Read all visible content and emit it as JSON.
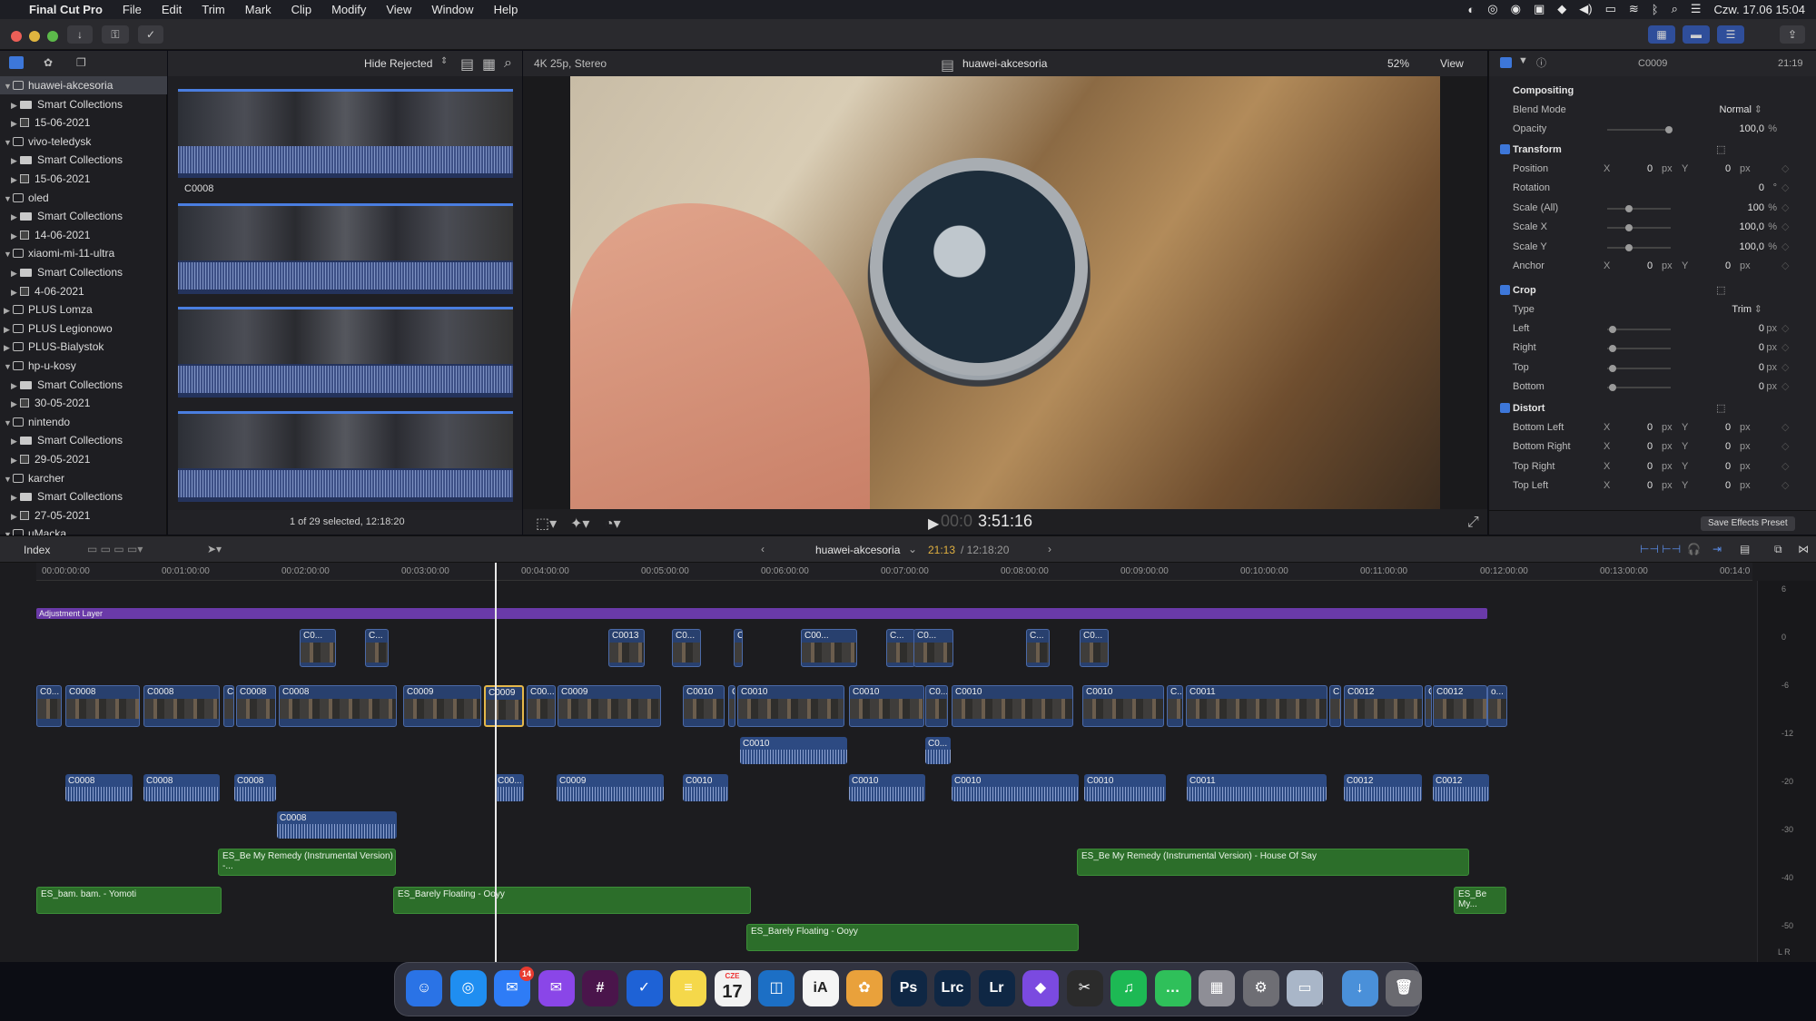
{
  "menubar": {
    "app_name": "Final Cut Pro",
    "items": [
      "File",
      "Edit",
      "Trim",
      "Mark",
      "Clip",
      "Modify",
      "View",
      "Window",
      "Help"
    ],
    "clock": "Czw. 17.06  15:04"
  },
  "libraries": {
    "items": [
      {
        "label": "huawei-akcesoria",
        "kind": "library",
        "selected": true
      },
      {
        "label": "Smart Collections",
        "kind": "folder"
      },
      {
        "label": "15-06-2021",
        "kind": "event"
      },
      {
        "label": "vivo-teledysk",
        "kind": "library"
      },
      {
        "label": "Smart Collections",
        "kind": "folder"
      },
      {
        "label": "15-06-2021",
        "kind": "event"
      },
      {
        "label": "oled",
        "kind": "library"
      },
      {
        "label": "Smart Collections",
        "kind": "folder"
      },
      {
        "label": "14-06-2021",
        "kind": "event"
      },
      {
        "label": "xiaomi-mi-11-ultra",
        "kind": "library"
      },
      {
        "label": "Smart Collections",
        "kind": "folder"
      },
      {
        "label": "4-06-2021",
        "kind": "event"
      },
      {
        "label": "PLUS Lomza",
        "kind": "library"
      },
      {
        "label": "PLUS Legionowo",
        "kind": "library"
      },
      {
        "label": "PLUS-Bialystok",
        "kind": "library"
      },
      {
        "label": "hp-u-kosy",
        "kind": "library"
      },
      {
        "label": "Smart Collections",
        "kind": "folder"
      },
      {
        "label": "30-05-2021",
        "kind": "event"
      },
      {
        "label": "nintendo",
        "kind": "library"
      },
      {
        "label": "Smart Collections",
        "kind": "folder"
      },
      {
        "label": "29-05-2021",
        "kind": "event"
      },
      {
        "label": "karcher",
        "kind": "library"
      },
      {
        "label": "Smart Collections",
        "kind": "folder"
      },
      {
        "label": "27-05-2021",
        "kind": "event"
      },
      {
        "label": "uMacka",
        "kind": "library"
      }
    ]
  },
  "browser": {
    "filter": "Hide Rejected",
    "clip_name": "C0008",
    "status": "1 of 29 selected, 12:18:20"
  },
  "viewer": {
    "format": "4K 25p, Stereo",
    "project": "huawei-akcesoria",
    "zoom": "52%",
    "view_menu": "View",
    "timecode_dim": "00:0",
    "timecode": "3:51:16"
  },
  "inspector": {
    "clip": "C0009",
    "duration": "21:19",
    "compositing": {
      "title": "Compositing",
      "blend_label": "Blend Mode",
      "blend": "Normal",
      "opacity_label": "Opacity",
      "opacity": "100,0"
    },
    "transform": {
      "title": "Transform",
      "rows": [
        {
          "label": "Position",
          "x": "0",
          "y": "0",
          "unit": "px"
        },
        {
          "label": "Rotation",
          "value": "0",
          "unit": "°"
        },
        {
          "label": "Scale (All)",
          "value": "100",
          "unit": "%"
        },
        {
          "label": "Scale X",
          "value": "100,0",
          "unit": "%"
        },
        {
          "label": "Scale Y",
          "value": "100,0",
          "unit": "%"
        },
        {
          "label": "Anchor",
          "x": "0",
          "y": "0",
          "unit": "px"
        }
      ]
    },
    "crop": {
      "title": "Crop",
      "type_label": "Type",
      "type": "Trim",
      "rows": [
        {
          "label": "Left",
          "value": "0",
          "unit": "px"
        },
        {
          "label": "Right",
          "value": "0",
          "unit": "px"
        },
        {
          "label": "Top",
          "value": "0",
          "unit": "px"
        },
        {
          "label": "Bottom",
          "value": "0",
          "unit": "px"
        }
      ]
    },
    "distort": {
      "title": "Distort",
      "rows": [
        {
          "label": "Bottom Left",
          "x": "0",
          "y": "0",
          "unit": "px"
        },
        {
          "label": "Bottom Right",
          "x": "0",
          "y": "0",
          "unit": "px"
        },
        {
          "label": "Top Right",
          "x": "0",
          "y": "0",
          "unit": "px"
        },
        {
          "label": "Top Left",
          "x": "0",
          "y": "0",
          "unit": "px"
        }
      ]
    },
    "save_preset": "Save Effects Preset"
  },
  "timeline": {
    "index_label": "Index",
    "project": "huawei-akcesoria",
    "position": "21:13",
    "duration": "/ 12:18:20",
    "ruler": [
      "00:00:00:00",
      "00:01:00:00",
      "00:02:00:00",
      "00:03:00:00",
      "00:04:00:00",
      "00:05:00:00",
      "00:06:00:00",
      "00:07:00:00",
      "00:08:00:00",
      "00:09:00:00",
      "00:10:00:00",
      "00:11:00:00",
      "00:12:00:00",
      "00:13:00:00",
      "00:14:0"
    ],
    "adjustment_layer": "Adjustment Layer",
    "primary": [
      "C0...",
      "C0008",
      "C0008",
      "C",
      "C0008",
      "C0008",
      "C0009",
      "C0009",
      "C00...",
      "C0009",
      "C0010",
      "C",
      "C0010",
      "C0010",
      "C0...",
      "C0010",
      "C0010",
      "C...",
      "C0011",
      "C...",
      "C0012",
      "C",
      "C0012",
      "o..."
    ],
    "connected_top": [
      "C0...",
      "C...",
      "C0013",
      "C0...",
      "C",
      "C00...",
      "C...",
      "C0...",
      "C...",
      "C0..."
    ],
    "audio": [
      "C0008",
      "C0008",
      "C0008",
      "C00...",
      "C0009",
      "C0010",
      "C0010",
      "C0010",
      "C0010",
      "C0011",
      "C0012",
      "C0012",
      "C0008",
      "C0010",
      "C0..."
    ],
    "music": [
      "ES_Be My Remedy (Instrumental Version) -...",
      "ES_Be My Remedy (Instrumental Version) - House Of Say",
      "ES_bam. bam. - Yomoti",
      "ES_Barely Floating - Ooyy",
      "ES_Be My...",
      "ES_Barely Floating - Ooyy"
    ],
    "meter_labels": [
      "6",
      "0",
      "-6",
      "-12",
      "-20",
      "-30",
      "-40",
      "-50"
    ],
    "meter_lr": "L   R"
  },
  "dock": {
    "apps": [
      "Finder",
      "Safari",
      "Mail",
      "Messenger",
      "Slack",
      "Tasks",
      "Notes",
      "Calendar",
      "Trello",
      "iA",
      "Photos",
      "Ps",
      "Lrc",
      "Lr",
      "Affinity",
      "Final Cut",
      "Spotify",
      "Messages",
      "Launchpad",
      "Settings",
      "Preview",
      "Downloads",
      "Trash"
    ],
    "mail_badge": "14",
    "calendar_month": "CZE",
    "calendar_day": "17"
  },
  "colors": {
    "accent": "#3d77d9",
    "video_clip": "#28406e",
    "music_clip": "#2c6e2a",
    "adjustment": "#6a3aa8",
    "selected_clip": "#e5b84a"
  }
}
